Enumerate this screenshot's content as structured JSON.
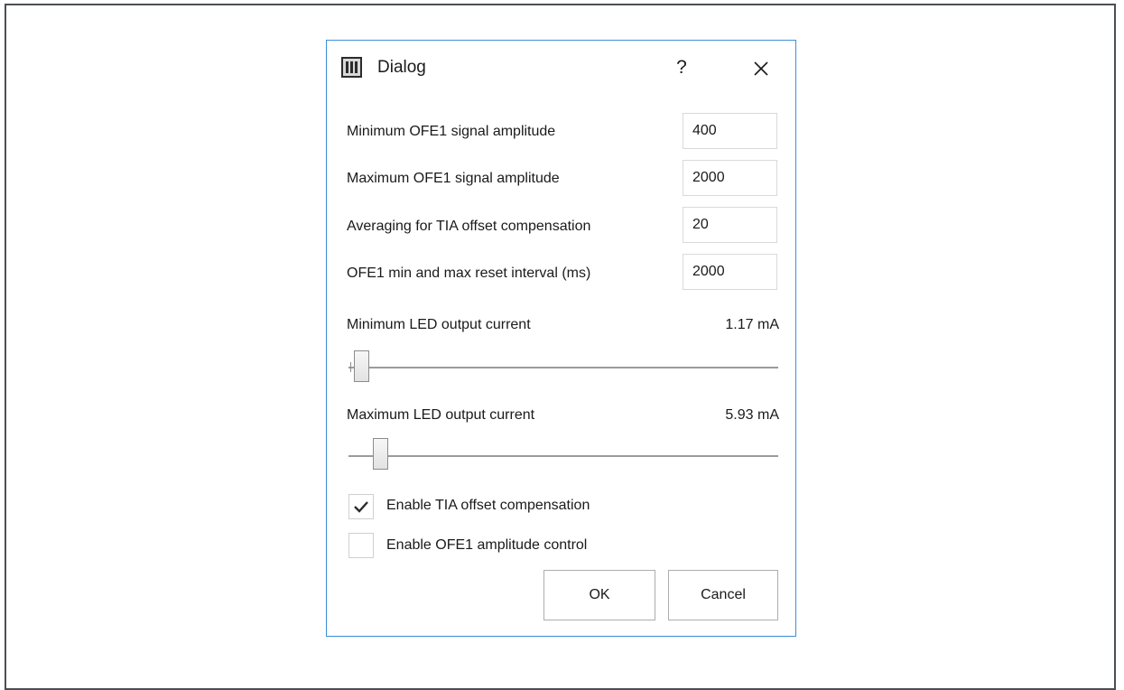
{
  "dialog": {
    "title": "Dialog",
    "help": "?",
    "fields": [
      {
        "label": "Minimum OFE1 signal amplitude",
        "value": "400"
      },
      {
        "label": "Maximum OFE1 signal amplitude",
        "value": "2000"
      },
      {
        "label": "Averaging for TIA offset compensation",
        "value": "20"
      },
      {
        "label": "OFE1 min and max reset interval (ms)",
        "value": "2000"
      }
    ],
    "sliders": [
      {
        "label": "Minimum LED output current",
        "value_text": "1.17 mA"
      },
      {
        "label": "Maximum LED output current",
        "value_text": "5.93 mA"
      }
    ],
    "checkboxes": [
      {
        "label": "Enable TIA offset compensation",
        "checked": true
      },
      {
        "label": "Enable OFE1 amplitude control",
        "checked": false
      }
    ],
    "buttons": {
      "ok": "OK",
      "cancel": "Cancel"
    }
  },
  "icons": {
    "app": "app-logo-icon",
    "close": "close-icon",
    "check": "checkmark-icon"
  },
  "colors": {
    "accent_border": "#3c8ed8"
  }
}
